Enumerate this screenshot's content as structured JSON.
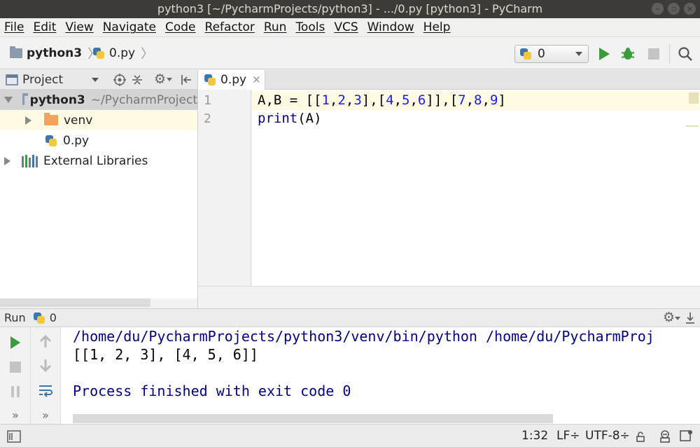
{
  "window": {
    "title": "python3 [~/PycharmProjects/python3] - .../0.py [python3] - PyCharm"
  },
  "menubar": {
    "items": [
      "File",
      "Edit",
      "View",
      "Navigate",
      "Code",
      "Refactor",
      "Run",
      "Tools",
      "VCS",
      "Window",
      "Help"
    ]
  },
  "navbar": {
    "breadcrumb": [
      "python3",
      "0.py"
    ],
    "run_config": "0"
  },
  "project_panel": {
    "title": "Project",
    "root": {
      "name": "python3",
      "path": "~/PycharmProject"
    },
    "children": [
      {
        "name": "venv",
        "icon": "folder-icon"
      },
      {
        "name": "0.py",
        "icon": "python-file-icon"
      }
    ],
    "external": "External Libraries"
  },
  "editor": {
    "tab": "0.py",
    "line_numbers": [
      "1",
      "2"
    ],
    "lines": [
      [
        {
          "t": "A,B = [[",
          "c": "plain"
        },
        {
          "t": "1",
          "c": "num"
        },
        {
          "t": ",",
          "c": "plain"
        },
        {
          "t": "2",
          "c": "num"
        },
        {
          "t": ",",
          "c": "plain"
        },
        {
          "t": "3",
          "c": "num"
        },
        {
          "t": "],[",
          "c": "plain"
        },
        {
          "t": "4",
          "c": "num"
        },
        {
          "t": ",",
          "c": "plain"
        },
        {
          "t": "5",
          "c": "num"
        },
        {
          "t": ",",
          "c": "plain"
        },
        {
          "t": "6",
          "c": "num"
        },
        {
          "t": "]],[",
          "c": "plain"
        },
        {
          "t": "7",
          "c": "num"
        },
        {
          "t": ",",
          "c": "plain"
        },
        {
          "t": "8",
          "c": "num"
        },
        {
          "t": ",",
          "c": "plain"
        },
        {
          "t": "9",
          "c": "num"
        },
        {
          "t": "]",
          "c": "plain"
        }
      ],
      [
        {
          "t": "print",
          "c": "fn"
        },
        {
          "t": "(A)",
          "c": "plain"
        }
      ]
    ]
  },
  "run_panel": {
    "label": "Run",
    "config": "0",
    "console": [
      {
        "text": "/home/du/PycharmProjects/python3/venv/bin/python /home/du/PycharmProj",
        "color": "#000080"
      },
      {
        "text": "[[1, 2, 3], [4, 5, 6]]",
        "color": "#000000"
      },
      {
        "text": "",
        "color": "#000000"
      },
      {
        "text": "Process finished with exit code 0",
        "color": "#000080"
      }
    ]
  },
  "statusbar": {
    "position": "1:32",
    "line_sep": "LF÷",
    "encoding": "UTF-8÷"
  },
  "colors": {
    "accent_green": "#3a9c3a",
    "keyword_blue": "#000080",
    "number_blue": "#1a1aff",
    "current_line": "#fffae3"
  }
}
